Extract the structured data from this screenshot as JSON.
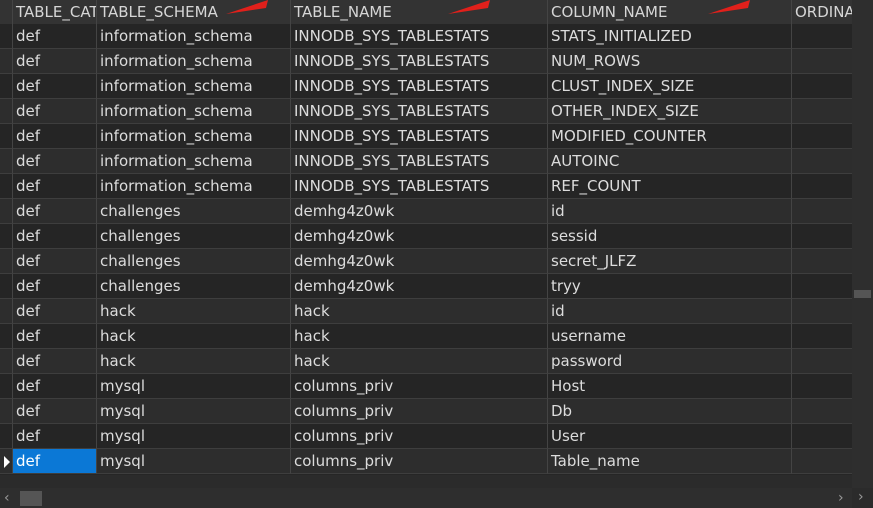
{
  "columns": [
    "TABLE_CAT",
    "TABLE_SCHEMA",
    "TABLE_NAME",
    "COLUMN_NAME",
    "ORDINA"
  ],
  "rows": [
    [
      "def",
      "information_schema",
      "INNODB_SYS_TABLESTATS",
      "STATS_INITIALIZED"
    ],
    [
      "def",
      "information_schema",
      "INNODB_SYS_TABLESTATS",
      "NUM_ROWS"
    ],
    [
      "def",
      "information_schema",
      "INNODB_SYS_TABLESTATS",
      "CLUST_INDEX_SIZE"
    ],
    [
      "def",
      "information_schema",
      "INNODB_SYS_TABLESTATS",
      "OTHER_INDEX_SIZE"
    ],
    [
      "def",
      "information_schema",
      "INNODB_SYS_TABLESTATS",
      "MODIFIED_COUNTER"
    ],
    [
      "def",
      "information_schema",
      "INNODB_SYS_TABLESTATS",
      "AUTOINC"
    ],
    [
      "def",
      "information_schema",
      "INNODB_SYS_TABLESTATS",
      "REF_COUNT"
    ],
    [
      "def",
      "challenges",
      "demhg4z0wk",
      "id"
    ],
    [
      "def",
      "challenges",
      "demhg4z0wk",
      "sessid"
    ],
    [
      "def",
      "challenges",
      "demhg4z0wk",
      "secret_JLFZ"
    ],
    [
      "def",
      "challenges",
      "demhg4z0wk",
      "tryy"
    ],
    [
      "def",
      "hack",
      "hack",
      "id"
    ],
    [
      "def",
      "hack",
      "hack",
      "username"
    ],
    [
      "def",
      "hack",
      "hack",
      "password"
    ],
    [
      "def",
      "mysql",
      "columns_priv",
      "Host"
    ],
    [
      "def",
      "mysql",
      "columns_priv",
      "Db"
    ],
    [
      "def",
      "mysql",
      "columns_priv",
      "User"
    ],
    [
      "def",
      "mysql",
      "columns_priv",
      "Table_name"
    ]
  ],
  "selected_row": 17,
  "colors": {
    "selection": "#0b78d6",
    "annotation_arrow": "#e0201b"
  },
  "icons": [
    "current-row-arrow-icon",
    "scroll-left-icon",
    "scroll-right-icon",
    "annotation-arrow-icon"
  ]
}
